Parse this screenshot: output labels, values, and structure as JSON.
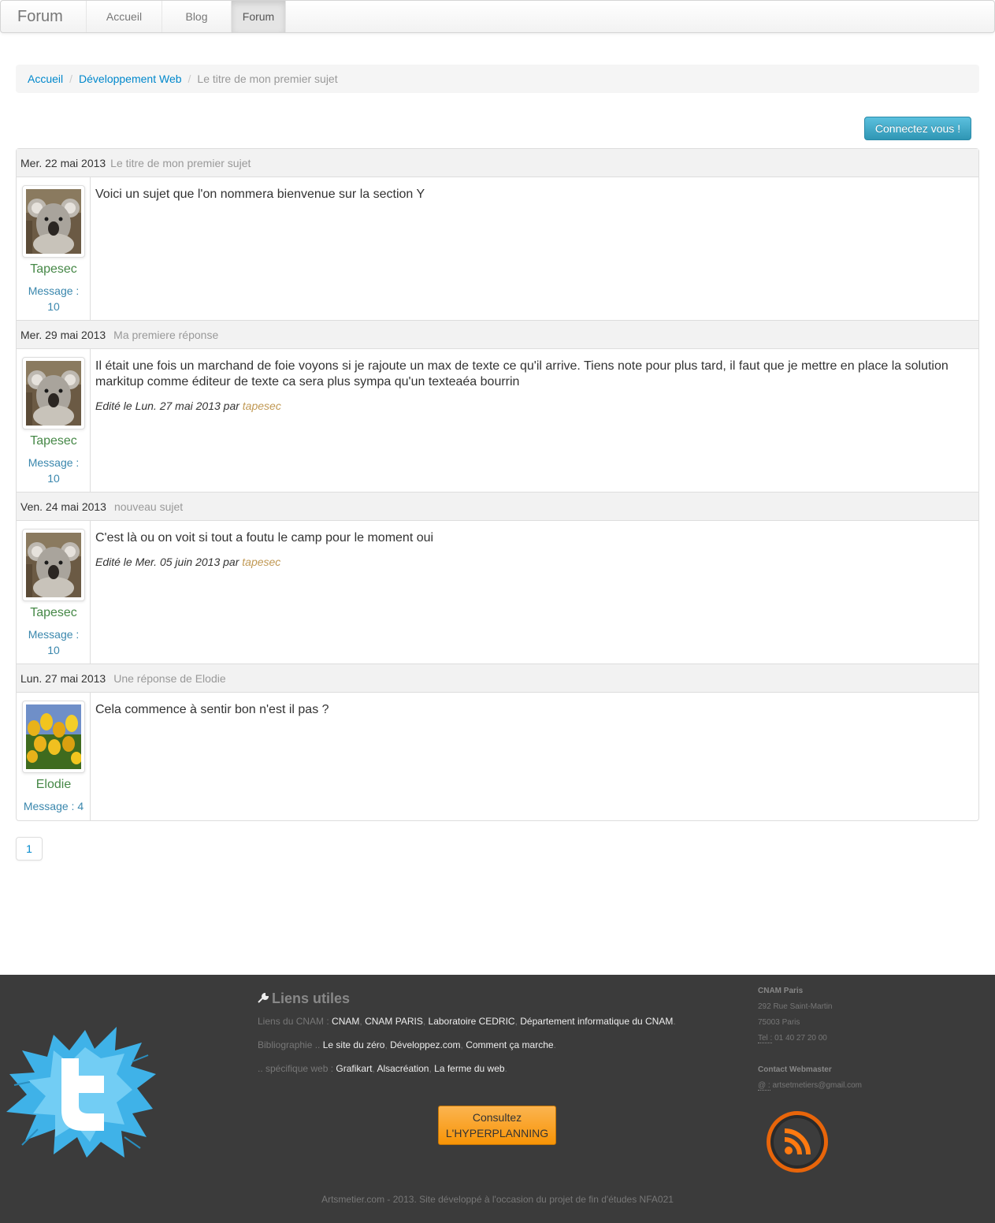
{
  "navbar": {
    "brand": "Forum",
    "items": [
      {
        "label": "Accueil",
        "active": false
      },
      {
        "label": "Blog",
        "active": false
      },
      {
        "label": "Forum",
        "active": true
      }
    ]
  },
  "breadcrumb": {
    "items": [
      {
        "label": "Accueil",
        "link": true
      },
      {
        "label": "Développement Web",
        "link": true
      },
      {
        "label": "Le titre de mon premier sujet",
        "link": false
      }
    ],
    "separator": "/"
  },
  "login_button": "Connectez vous !",
  "posts": [
    {
      "date": "Mer. 22 mai 2013",
      "title": "Le titre de mon premier sujet",
      "author": "Tapesec",
      "avatar": "koala",
      "message_label": "Message :",
      "message_count": "10",
      "content": "Voici un sujet que l'on nommera bienvenue sur la section Y",
      "edited": null
    },
    {
      "date": "Mer. 29 mai 2013",
      "title": "Ma premiere réponse",
      "author": "Tapesec",
      "avatar": "koala",
      "message_label": "Message :",
      "message_count": "10",
      "content": "Il était une fois un marchand de foie voyons si je rajoute un max de texte ce qu'il arrive. Tiens note pour plus tard, il faut que je mettre en place la solution markitup comme éditeur de texte ca sera plus sympa qu'un texteaéa bourrin",
      "edited": {
        "prefix": "Edité le Lun. 27 mai 2013 par",
        "by": "tapesec"
      }
    },
    {
      "date": "Ven. 24 mai 2013",
      "title": "nouveau sujet",
      "author": "Tapesec",
      "avatar": "koala",
      "message_label": "Message :",
      "message_count": "10",
      "content": "C'est là ou on voit si tout a foutu le camp pour le moment oui",
      "edited": {
        "prefix": "Edité le Mer. 05 juin 2013 par",
        "by": "tapesec"
      }
    },
    {
      "date": "Lun. 27 mai 2013",
      "title": "Une réponse de Elodie",
      "author": "Elodie",
      "avatar": "tulips",
      "message_label": "Message :",
      "message_count": "4",
      "content": "Cela commence à sentir bon n'est il pas ?",
      "edited": null
    }
  ],
  "pagination": {
    "current": "1"
  },
  "footer": {
    "links_title": "Liens utiles",
    "lines": [
      {
        "prefix": "Liens du CNAM :",
        "links": [
          "CNAM",
          "CNAM PARIS",
          "Laboratoire CEDRIC",
          "Département informatique du CNAM"
        ],
        "suffix": "."
      },
      {
        "prefix": "Bibliographie ..",
        "links": [
          "Le site du zéro",
          "Développez.com",
          "Comment ça marche"
        ],
        "suffix": "."
      },
      {
        "prefix": ".. spécifique web :",
        "links": [
          "Grafikart",
          "Alsacréation",
          "La ferme du web"
        ],
        "suffix": "."
      }
    ],
    "hyperplanning": {
      "line1": "Consultez",
      "line2": "L'HYPERPLANNING"
    },
    "contact": {
      "org": "CNAM Paris",
      "street": "292 Rue Saint-Martin",
      "city": "75003 Paris",
      "tel_label": "Tel :",
      "tel": "01 40 27 20 00",
      "webmaster_title": "Contact Webmaster",
      "email_label": "@ :",
      "email": "artsetmetiers@gmail.com"
    },
    "copyright": "Artsmetier.com - 2013. Site développé à l'occasion du projet de fin d'études NFA021"
  },
  "colors": {
    "link": "#0088cc",
    "author": "#468847",
    "msg": "#3a87ad",
    "editor": "#c09853",
    "info_btn": "#49afcd",
    "warning_btn": "#faa732",
    "footer_bg": "#3b3b3b"
  },
  "icons": [
    "wrench-icon",
    "twitter-logo",
    "rss-icon"
  ]
}
